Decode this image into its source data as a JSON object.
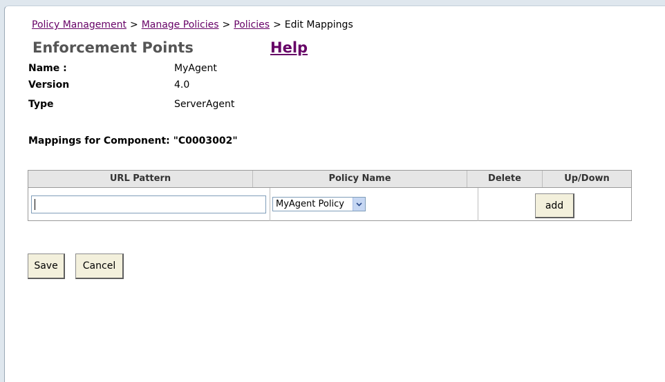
{
  "breadcrumb": {
    "items": [
      {
        "label": "Policy Management"
      },
      {
        "label": "Manage Policies"
      },
      {
        "label": "Policies"
      }
    ],
    "separator": ">",
    "current": "Edit Mappings"
  },
  "page": {
    "title": "Enforcement Points",
    "help_label": "Help"
  },
  "info": {
    "name_label": "Name :",
    "name_value": "MyAgent",
    "version_label": "Version",
    "version_value": "4.0",
    "type_label": "Type",
    "type_value": "ServerAgent"
  },
  "mappings": {
    "heading": "Mappings for Component: \"C0003002\"",
    "columns": [
      "URL Pattern",
      "Policy Name",
      "Delete",
      "Up/Down"
    ],
    "row": {
      "url_value": "",
      "policy_selected": "MyAgent Policy",
      "add_label": "add"
    }
  },
  "actions": {
    "save_label": "Save",
    "cancel_label": "Cancel"
  },
  "icons": {
    "dropdown": "chevron-down-icon"
  },
  "colors": {
    "link": "#660066",
    "title": "#555555",
    "header_bg": "#e6e6e6",
    "button_bg": "#f3f0dc"
  }
}
